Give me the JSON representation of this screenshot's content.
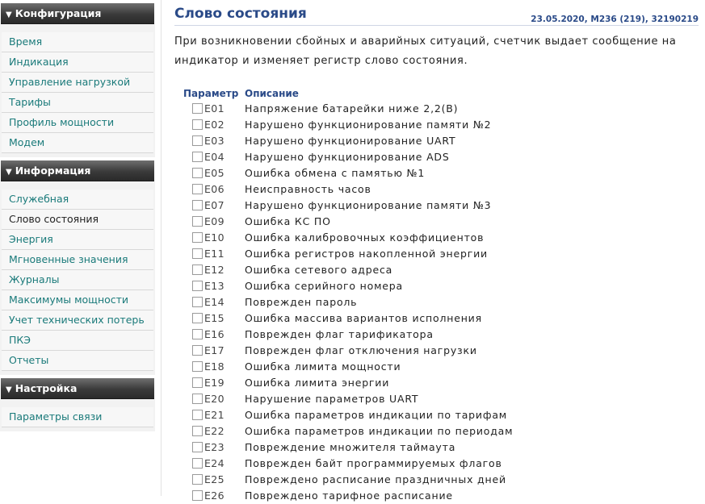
{
  "sidebar": {
    "sections": [
      {
        "title": "Конфигурация",
        "items": [
          "Время",
          "Индикация",
          "Управление нагрузкой",
          "Тарифы",
          "Профиль мощности",
          "Модем"
        ]
      },
      {
        "title": "Информация",
        "items": [
          "Служебная",
          "Слово состояния",
          "Энергия",
          "Мгновенные значения",
          "Журналы",
          "Максимумы мощности",
          "Учет технических потерь",
          "ПКЭ",
          "Отчеты"
        ]
      },
      {
        "title": "Настройка",
        "items": [
          "Параметры связи"
        ]
      }
    ],
    "active_item": "Слово состояния"
  },
  "main": {
    "title": "Слово состояния",
    "meta": "23.05.2020, M236 (219), 32190219",
    "intro": "При возникновении сбойных и аварийных ситуаций, счетчик выдает сообщение на индикатор и изменяет регистр слово состояния.",
    "table": {
      "param_header": "Параметр",
      "desc_header": "Описание",
      "rows": [
        {
          "code": "E01",
          "desc": "Напряжение батарейки ниже 2,2(В)"
        },
        {
          "code": "E02",
          "desc": "Нарушено функционирование памяти №2"
        },
        {
          "code": "E03",
          "desc": "Нарушено функционирование UART"
        },
        {
          "code": "E04",
          "desc": "Нарушено функционирование ADS"
        },
        {
          "code": "E05",
          "desc": "Ошибка обмена с памятью №1"
        },
        {
          "code": "E06",
          "desc": "Неисправность часов"
        },
        {
          "code": "E07",
          "desc": "Нарушено функционирование памяти №3"
        },
        {
          "code": "E09",
          "desc": "Ошибка КС ПО"
        },
        {
          "code": "E10",
          "desc": "Ошибка калибровочных коэффициентов"
        },
        {
          "code": "E11",
          "desc": "Ошибка регистров накопленной энергии"
        },
        {
          "code": "E12",
          "desc": "Ошибка сетевого адреса"
        },
        {
          "code": "E13",
          "desc": "Ошибка серийного номера"
        },
        {
          "code": "E14",
          "desc": "Поврежден пароль"
        },
        {
          "code": "E15",
          "desc": "Ошибка массива вариантов исполнения"
        },
        {
          "code": "E16",
          "desc": "Поврежден флаг тарификатора"
        },
        {
          "code": "E17",
          "desc": "Поврежден флаг отключения нагрузки"
        },
        {
          "code": "E18",
          "desc": "Ошибка лимита мощности"
        },
        {
          "code": "E19",
          "desc": "Ошибка лимита энергии"
        },
        {
          "code": "E20",
          "desc": "Нарушение параметров UART"
        },
        {
          "code": "E21",
          "desc": "Ошибка параметров индикации по тарифам"
        },
        {
          "code": "E22",
          "desc": "Ошибка параметров индикации по периодам"
        },
        {
          "code": "E23",
          "desc": "Повреждение множителя таймаута"
        },
        {
          "code": "E24",
          "desc": "Поврежден байт программируемых флагов"
        },
        {
          "code": "E25",
          "desc": "Повреждено расписание праздничных дней"
        },
        {
          "code": "E26",
          "desc": "Повреждено тарифное расписание"
        }
      ]
    }
  },
  "icons": {
    "section_toggle": "triangle-down-icon",
    "row_checkbox": "checkbox-icon"
  },
  "colors": {
    "title": "#2a4a88",
    "link": "#1a7a7a",
    "header_bg": "#3a3a3a"
  }
}
